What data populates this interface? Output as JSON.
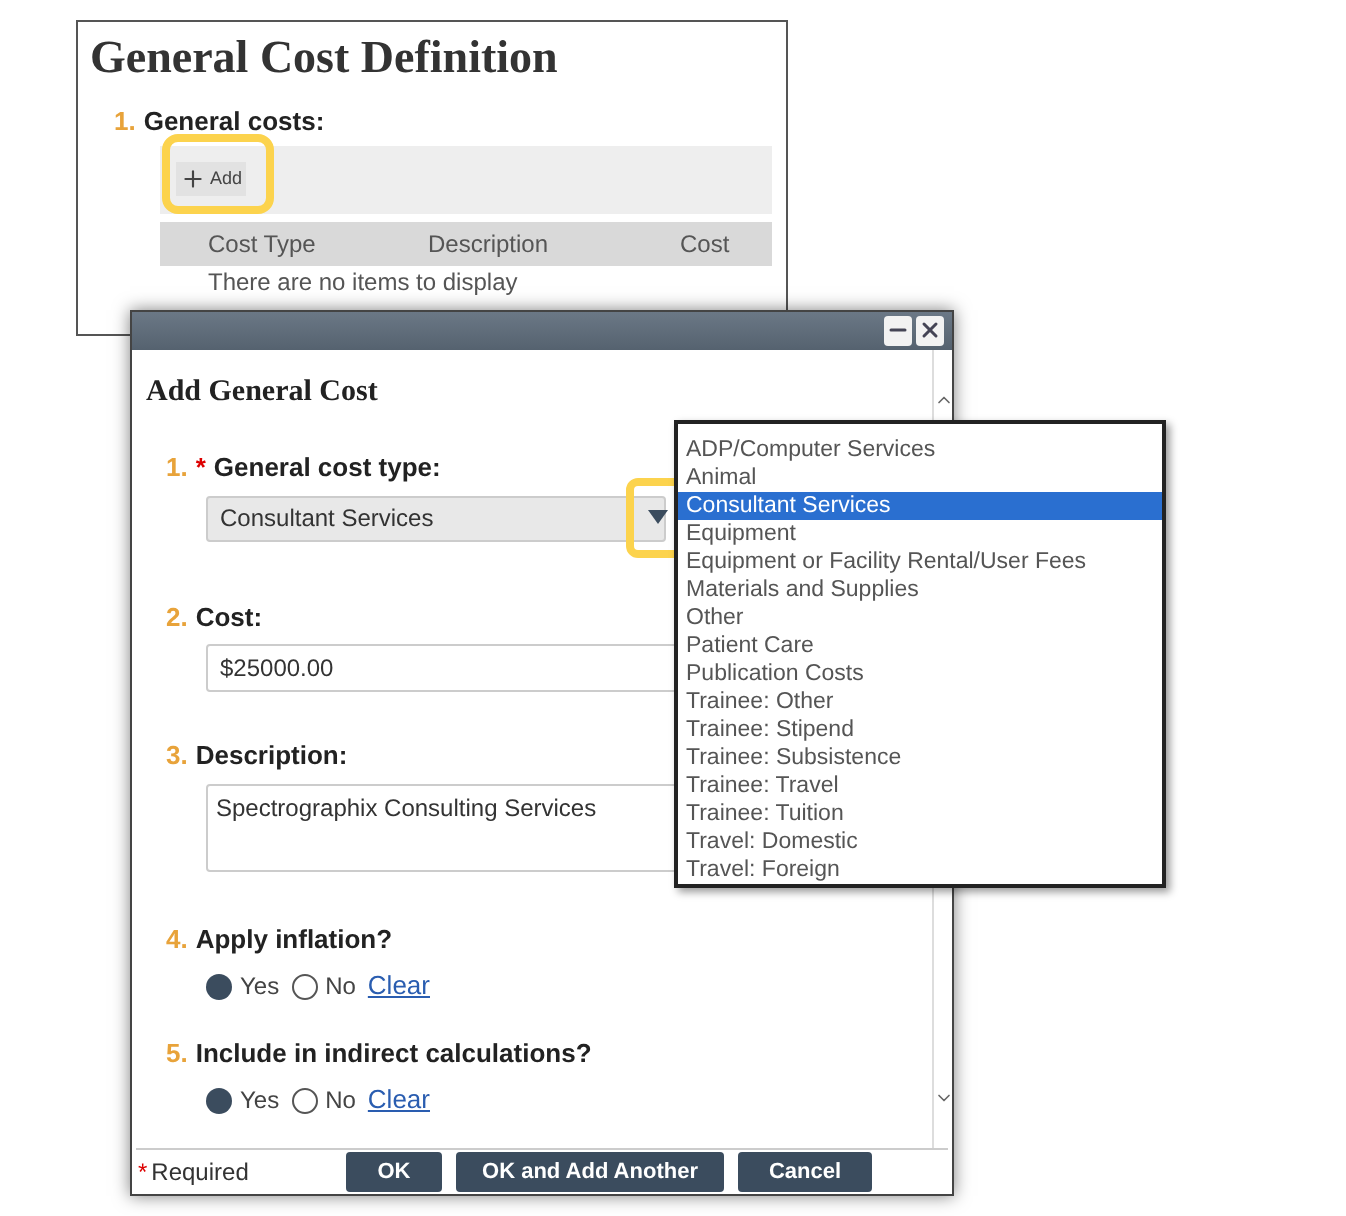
{
  "page": {
    "title": "General Cost Definition",
    "section": {
      "number": "1.",
      "label": "General costs:",
      "add_button": {
        "label": "Add",
        "highlighted": true
      },
      "columns": [
        "Cost Type",
        "Description",
        "Cost"
      ],
      "empty_message": "There are no items to display"
    }
  },
  "dialog": {
    "title": "Add General Cost",
    "fields": [
      {
        "kind": "select",
        "number": "1.",
        "required_mark": "*",
        "label": "General cost type:",
        "value": "Consultant Services",
        "arrow_highlighted": true
      },
      {
        "kind": "text",
        "number": "2.",
        "label": "Cost:",
        "value": "$25000.00"
      },
      {
        "kind": "textarea",
        "number": "3.",
        "label": "Description:",
        "value": "Spectrographix Consulting Services"
      },
      {
        "kind": "radio",
        "number": "4.",
        "label": "Apply inflation?",
        "options": [
          {
            "label": "Yes",
            "selected": true
          },
          {
            "label": "No",
            "selected": false
          }
        ],
        "clear": "Clear"
      },
      {
        "kind": "radio",
        "number": "5.",
        "label": "Include in indirect calculations?",
        "options": [
          {
            "label": "Yes",
            "selected": true
          },
          {
            "label": "No",
            "selected": false
          }
        ],
        "clear": "Clear"
      }
    ],
    "required_note": {
      "mark": "*",
      "label": "Required"
    },
    "buttons": [
      "OK",
      "OK and Add Another",
      "Cancel"
    ]
  },
  "dropdown_list": {
    "items": [
      {
        "label": "ADP/Computer Services",
        "selected": false
      },
      {
        "label": "Animal",
        "selected": false
      },
      {
        "label": "Consultant Services",
        "selected": true
      },
      {
        "label": "Equipment",
        "selected": false
      },
      {
        "label": "Equipment or Facility Rental/User Fees",
        "selected": false
      },
      {
        "label": "Materials and Supplies",
        "selected": false
      },
      {
        "label": "Other",
        "selected": false
      },
      {
        "label": "Patient Care",
        "selected": false
      },
      {
        "label": "Publication Costs",
        "selected": false
      },
      {
        "label": "Trainee: Other",
        "selected": false
      },
      {
        "label": "Trainee: Stipend",
        "selected": false
      },
      {
        "label": "Trainee: Subsistence",
        "selected": false
      },
      {
        "label": "Trainee: Travel",
        "selected": false
      },
      {
        "label": "Trainee: Tuition",
        "selected": false
      },
      {
        "label": "Travel: Domestic",
        "selected": false
      },
      {
        "label": "Travel: Foreign",
        "selected": false
      }
    ]
  }
}
